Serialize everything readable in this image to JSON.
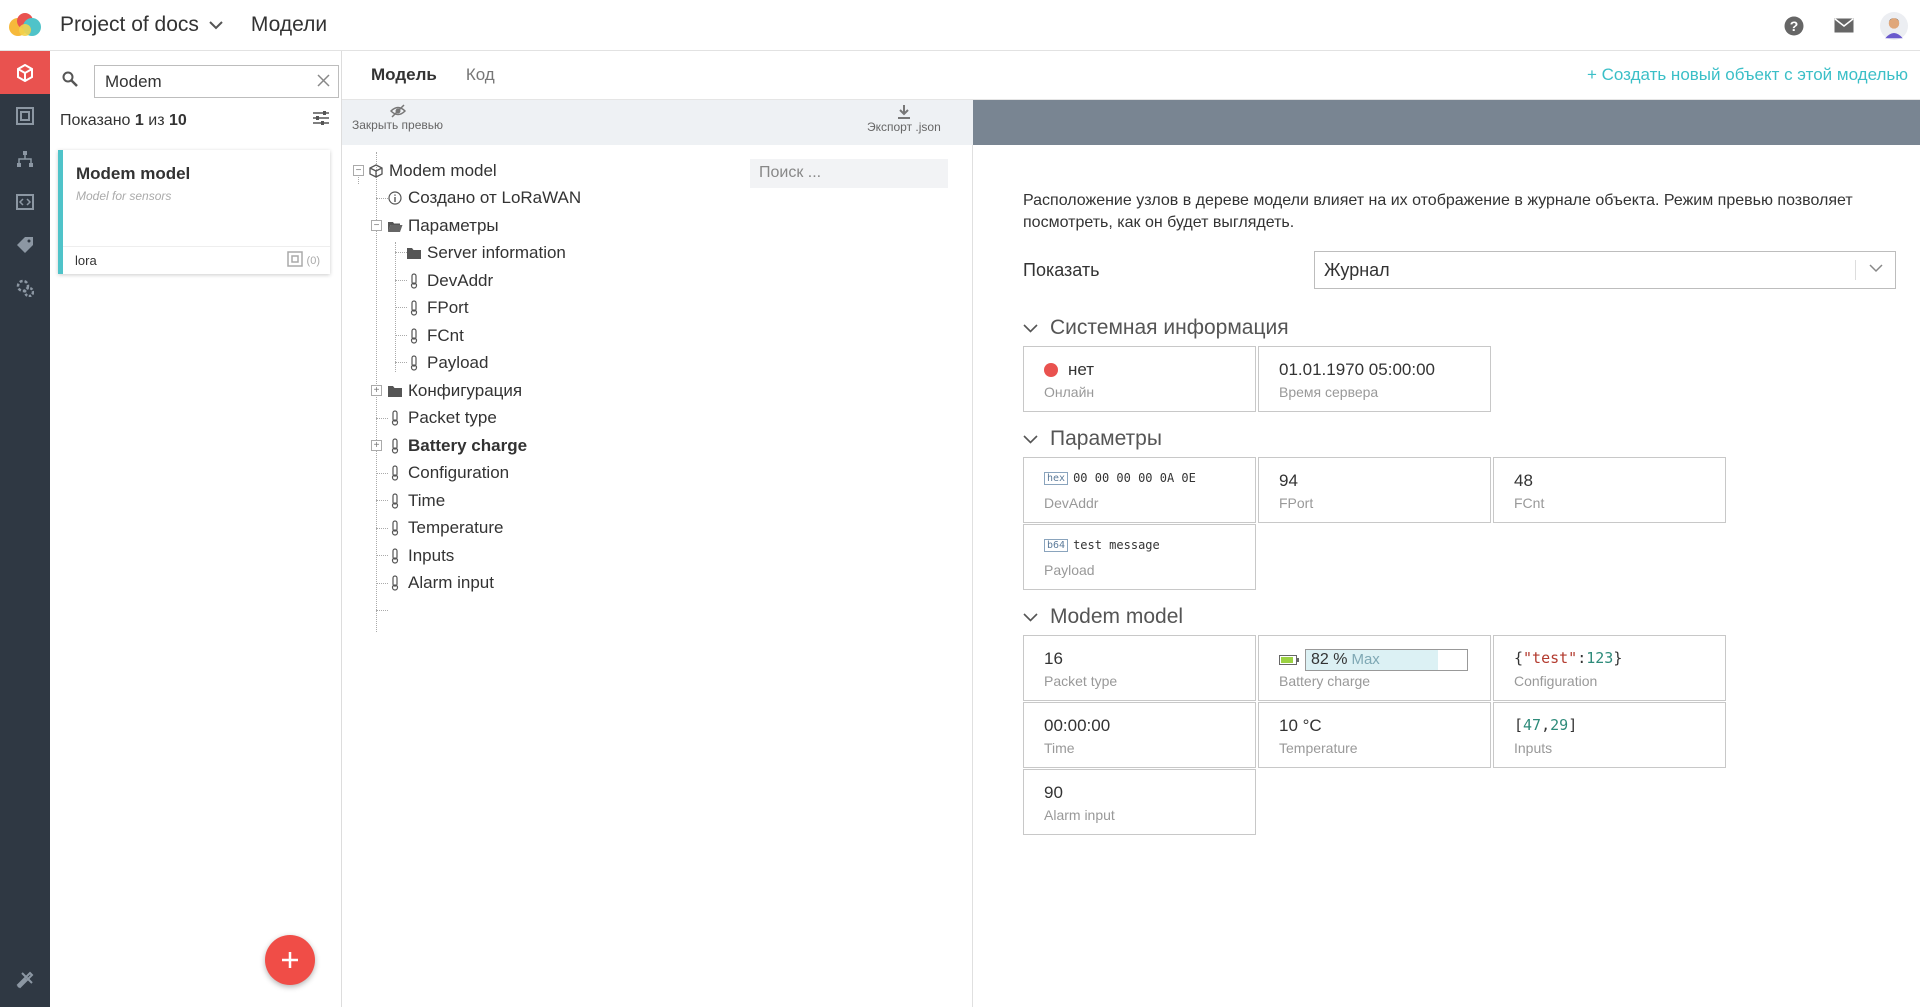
{
  "header": {
    "project": "Project of docs",
    "section": "Модели"
  },
  "list": {
    "search_value": "Modem",
    "shown_prefix": "Показано",
    "shown_count": "1",
    "shown_sep": "из",
    "shown_total": "10",
    "card": {
      "title": "Modem model",
      "subtitle": "Model for sensors",
      "tag": "lora",
      "count": "(0)"
    }
  },
  "tabs": {
    "model": "Модель",
    "code": "Код",
    "create_link": "+ Создать новый объект с этой моделью"
  },
  "tree_toolbar": {
    "close_preview": "Закрыть превью",
    "export": "Экспорт .json",
    "search_placeholder": "Поиск ..."
  },
  "tree": {
    "root": "Modem model",
    "created": "Создано от LoRaWAN",
    "params": "Параметры",
    "server_info": "Server information",
    "devaddr": "DevAddr",
    "fport": "FPort",
    "fcnt": "FCnt",
    "payload": "Payload",
    "config_folder": "Конфигурация",
    "packet_type": "Packet type",
    "battery": "Battery charge",
    "configuration": "Configuration",
    "time": "Time",
    "temperature": "Temperature",
    "inputs": "Inputs",
    "alarm": "Alarm input"
  },
  "preview": {
    "description": "Расположение узлов в дереве модели влияет на их отображение в журнале объекта. Режим превью позволяет посмотреть, как он будет выглядеть.",
    "show_label": "Показать",
    "show_value": "Журнал",
    "groups": {
      "system": "Системная информация",
      "params": "Параметры",
      "modem": "Modem model"
    },
    "online": {
      "value": "нет",
      "label": "Онлайн",
      "color": "#e9524f"
    },
    "server_time": {
      "value": "01.01.1970 05:00:00",
      "label": "Время сервера"
    },
    "devaddr": {
      "tag": "hex",
      "value": "00 00 00 00 0A 0E",
      "label": "DevAddr"
    },
    "fport": {
      "value": "94",
      "label": "FPort"
    },
    "fcnt": {
      "value": "48",
      "label": "FCnt"
    },
    "payload": {
      "tag": "b64",
      "value": "test message",
      "label": "Payload"
    },
    "packet_type": {
      "value": "16",
      "label": "Packet type"
    },
    "battery": {
      "value": "82 %",
      "max": "Max",
      "label": "Battery charge",
      "level": 0.82
    },
    "configuration": {
      "open": "{",
      "key": "\"test\"",
      "colon": ":",
      "num": "123",
      "close": "}",
      "label": "Configuration"
    },
    "time": {
      "value": "00:00:00",
      "label": "Time"
    },
    "temperature": {
      "value": "10 °C",
      "label": "Temperature"
    },
    "inputs": {
      "open": "[",
      "a": "47",
      "comma": ",",
      "b": "29",
      "close": "]",
      "label": "Inputs"
    },
    "alarm": {
      "value": "90",
      "label": "Alarm input"
    }
  }
}
